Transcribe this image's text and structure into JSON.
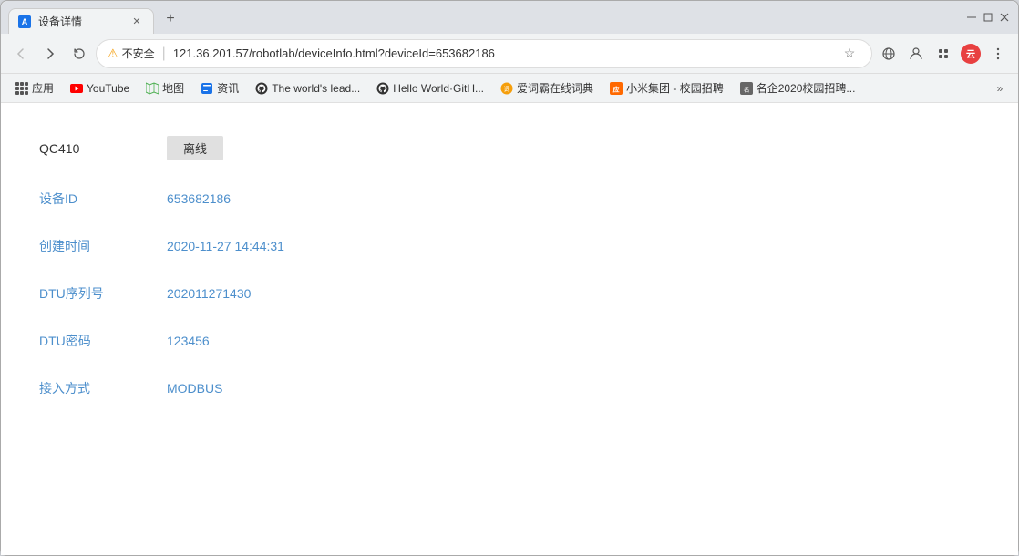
{
  "window": {
    "title": "设备详情",
    "tab_icon": "A"
  },
  "address_bar": {
    "security_label": "不安全",
    "url": "121.36.201.57/robotlab/deviceInfo.html?deviceId=653682186"
  },
  "bookmarks": [
    {
      "id": "apps",
      "label": "应用",
      "type": "apps"
    },
    {
      "id": "youtube",
      "label": "YouTube",
      "type": "youtube"
    },
    {
      "id": "maps",
      "label": "地图",
      "type": "maps"
    },
    {
      "id": "news",
      "label": "资讯",
      "type": "news"
    },
    {
      "id": "github",
      "label": "The world's lead...",
      "type": "github"
    },
    {
      "id": "github2",
      "label": "Hello World·GitH...",
      "type": "github2"
    },
    {
      "id": "dict",
      "label": "爱词霸在线词典",
      "type": "dict"
    },
    {
      "id": "xiaomi",
      "label": "小米集团 - 校园招聘",
      "type": "xiaomi"
    },
    {
      "id": "campus",
      "label": "名企2020校园招聘...",
      "type": "campus"
    }
  ],
  "device": {
    "name": "QC410",
    "status_label": "离线",
    "fields": [
      {
        "label": "设备ID",
        "value": "653682186"
      },
      {
        "label": "创建时间",
        "value": "2020-11-27 14:44:31"
      },
      {
        "label": "DTU序列号",
        "value": "202011271430"
      },
      {
        "label": "DTU密码",
        "value": "123456"
      },
      {
        "label": "接入方式",
        "value": "MODBUS"
      }
    ]
  }
}
